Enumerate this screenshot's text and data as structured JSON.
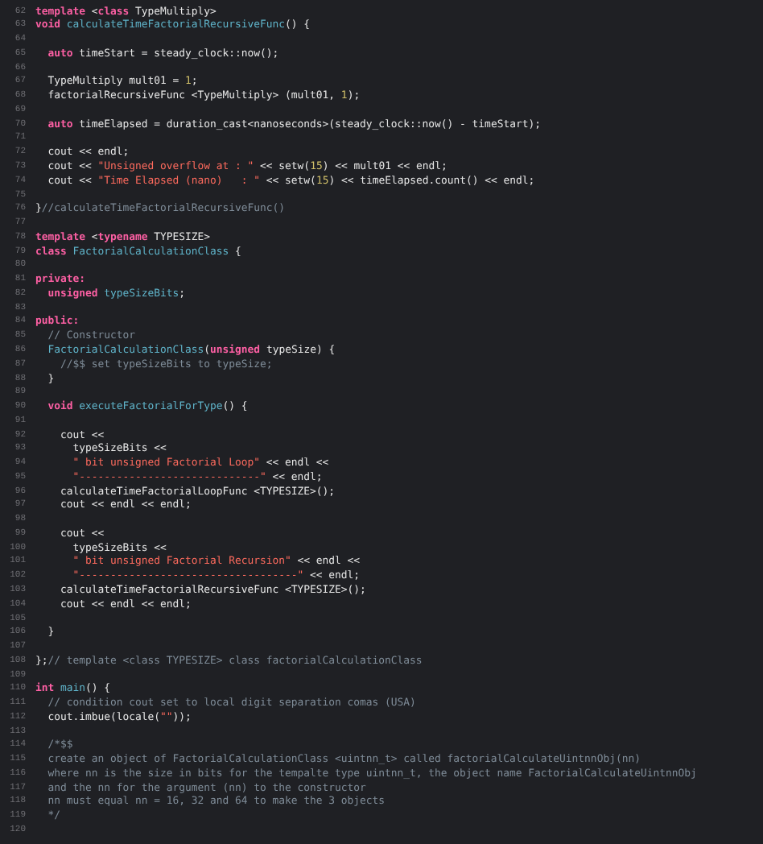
{
  "editor": {
    "lines": [
      {
        "number": "62",
        "tokens": [
          {
            "kind": "keyword",
            "text": "template"
          },
          {
            "kind": "plain",
            "text": " <"
          },
          {
            "kind": "keyword",
            "text": "class"
          },
          {
            "kind": "plain",
            "text": " TypeMultiply>"
          }
        ]
      },
      {
        "number": "63",
        "tokens": [
          {
            "kind": "keyword",
            "text": "void "
          },
          {
            "kind": "function",
            "text": "calculateTimeFactorialRecursiveFunc"
          },
          {
            "kind": "plain",
            "text": "() {"
          }
        ]
      },
      {
        "number": "64"
      },
      {
        "number": "65",
        "tokens": [
          {
            "kind": "keyword",
            "text": "  auto"
          },
          {
            "kind": "plain",
            "text": " timeStart = steady_clock::now();"
          }
        ]
      },
      {
        "number": "66"
      },
      {
        "number": "67",
        "tokens": [
          {
            "kind": "plain",
            "text": "  TypeMultiply mult01 = "
          },
          {
            "kind": "number",
            "text": "1"
          },
          {
            "kind": "plain",
            "text": ";"
          }
        ]
      },
      {
        "number": "68",
        "tokens": [
          {
            "kind": "plain",
            "text": "  factorialRecursiveFunc <TypeMultiply> (mult01, "
          },
          {
            "kind": "number",
            "text": "1"
          },
          {
            "kind": "plain",
            "text": ");"
          }
        ]
      },
      {
        "number": "69"
      },
      {
        "number": "70",
        "tokens": [
          {
            "kind": "keyword",
            "text": "  auto"
          },
          {
            "kind": "plain",
            "text": " timeElapsed = duration_cast<nanoseconds>(steady_clock::now() - timeStart);"
          }
        ]
      },
      {
        "number": "71"
      },
      {
        "number": "72",
        "tokens": [
          {
            "kind": "plain",
            "text": "  cout << endl;"
          }
        ]
      },
      {
        "number": "73",
        "tokens": [
          {
            "kind": "plain",
            "text": "  cout << "
          },
          {
            "kind": "string",
            "text": "\"Unsigned overflow at : \""
          },
          {
            "kind": "plain",
            "text": " << setw("
          },
          {
            "kind": "number",
            "text": "15"
          },
          {
            "kind": "plain",
            "text": ") << mult01 << endl;"
          }
        ]
      },
      {
        "number": "74",
        "tokens": [
          {
            "kind": "plain",
            "text": "  cout << "
          },
          {
            "kind": "string",
            "text": "\"Time Elapsed (nano)   : \""
          },
          {
            "kind": "plain",
            "text": " << setw("
          },
          {
            "kind": "number",
            "text": "15"
          },
          {
            "kind": "plain",
            "text": ") << timeElapsed.count() << endl;"
          }
        ]
      },
      {
        "number": "75"
      },
      {
        "number": "76",
        "tokens": [
          {
            "kind": "plain",
            "text": "}"
          },
          {
            "kind": "comment",
            "text": "//calculateTimeFactorialRecursiveFunc()"
          }
        ]
      },
      {
        "number": "77"
      },
      {
        "number": "78",
        "tokens": [
          {
            "kind": "keyword",
            "text": "template"
          },
          {
            "kind": "plain",
            "text": " <"
          },
          {
            "kind": "keyword",
            "text": "typename"
          },
          {
            "kind": "plain",
            "text": " TYPESIZE>"
          }
        ]
      },
      {
        "number": "79",
        "tokens": [
          {
            "kind": "keyword",
            "text": "class "
          },
          {
            "kind": "function",
            "text": "FactorialCalculationClass"
          },
          {
            "kind": "plain",
            "text": " {"
          }
        ]
      },
      {
        "number": "80"
      },
      {
        "number": "81",
        "tokens": [
          {
            "kind": "keyword",
            "text": "private:"
          }
        ]
      },
      {
        "number": "82",
        "tokens": [
          {
            "kind": "keyword",
            "text": "  unsigned "
          },
          {
            "kind": "function",
            "text": "typeSizeBits"
          },
          {
            "kind": "plain",
            "text": ";"
          }
        ]
      },
      {
        "number": "83"
      },
      {
        "number": "84",
        "tokens": [
          {
            "kind": "keyword",
            "text": "public:"
          }
        ]
      },
      {
        "number": "85",
        "tokens": [
          {
            "kind": "comment",
            "text": "  // Constructor"
          }
        ]
      },
      {
        "number": "86",
        "tokens": [
          {
            "kind": "function",
            "text": "  FactorialCalculationClass"
          },
          {
            "kind": "plain",
            "text": "("
          },
          {
            "kind": "keyword",
            "text": "unsigned"
          },
          {
            "kind": "plain",
            "text": " typeSize) {"
          }
        ]
      },
      {
        "number": "87",
        "tokens": [
          {
            "kind": "comment",
            "text": "    //$$ set typeSizeBits to typeSize;"
          }
        ]
      },
      {
        "number": "88",
        "tokens": [
          {
            "kind": "plain",
            "text": "  }"
          }
        ]
      },
      {
        "number": "89"
      },
      {
        "number": "90",
        "tokens": [
          {
            "kind": "keyword",
            "text": "  void "
          },
          {
            "kind": "function",
            "text": "executeFactorialForType"
          },
          {
            "kind": "plain",
            "text": "() {"
          }
        ]
      },
      {
        "number": "91"
      },
      {
        "number": "92",
        "tokens": [
          {
            "kind": "plain",
            "text": "    cout <<"
          }
        ]
      },
      {
        "number": "93",
        "tokens": [
          {
            "kind": "plain",
            "text": "      typeSizeBits <<"
          }
        ]
      },
      {
        "number": "94",
        "tokens": [
          {
            "kind": "string",
            "text": "      \" bit unsigned Factorial Loop\""
          },
          {
            "kind": "plain",
            "text": " << endl <<"
          }
        ]
      },
      {
        "number": "95",
        "tokens": [
          {
            "kind": "string",
            "text": "      \"-----------------------------\""
          },
          {
            "kind": "plain",
            "text": " << endl;"
          }
        ]
      },
      {
        "number": "96",
        "tokens": [
          {
            "kind": "plain",
            "text": "    calculateTimeFactorialLoopFunc <TYPESIZE>();"
          }
        ]
      },
      {
        "number": "97",
        "tokens": [
          {
            "kind": "plain",
            "text": "    cout << endl << endl;"
          }
        ]
      },
      {
        "number": "98"
      },
      {
        "number": "99",
        "tokens": [
          {
            "kind": "plain",
            "text": "    cout <<"
          }
        ]
      },
      {
        "number": "100",
        "tokens": [
          {
            "kind": "plain",
            "text": "      typeSizeBits <<"
          }
        ]
      },
      {
        "number": "101",
        "tokens": [
          {
            "kind": "string",
            "text": "      \" bit unsigned Factorial Recursion\""
          },
          {
            "kind": "plain",
            "text": " << endl <<"
          }
        ]
      },
      {
        "number": "102",
        "tokens": [
          {
            "kind": "string",
            "text": "      \"-----------------------------------\""
          },
          {
            "kind": "plain",
            "text": " << endl;"
          }
        ]
      },
      {
        "number": "103",
        "tokens": [
          {
            "kind": "plain",
            "text": "    calculateTimeFactorialRecursiveFunc <TYPESIZE>();"
          }
        ]
      },
      {
        "number": "104",
        "tokens": [
          {
            "kind": "plain",
            "text": "    cout << endl << endl;"
          }
        ]
      },
      {
        "number": "105"
      },
      {
        "number": "106",
        "tokens": [
          {
            "kind": "plain",
            "text": "  }"
          }
        ]
      },
      {
        "number": "107"
      },
      {
        "number": "108",
        "tokens": [
          {
            "kind": "plain",
            "text": "};"
          },
          {
            "kind": "comment",
            "text": "// template <class TYPESIZE> class factorialCalculationClass"
          }
        ]
      },
      {
        "number": "109"
      },
      {
        "number": "110",
        "tokens": [
          {
            "kind": "keyword",
            "text": "int "
          },
          {
            "kind": "function",
            "text": "main"
          },
          {
            "kind": "plain",
            "text": "() {"
          }
        ]
      },
      {
        "number": "111",
        "tokens": [
          {
            "kind": "comment",
            "text": "  // condition cout set to local digit separation comas (USA)"
          }
        ]
      },
      {
        "number": "112",
        "tokens": [
          {
            "kind": "plain",
            "text": "  cout.imbue(locale("
          },
          {
            "kind": "string",
            "text": "\"\""
          },
          {
            "kind": "plain",
            "text": "));"
          }
        ]
      },
      {
        "number": "113"
      },
      {
        "number": "114",
        "tokens": [
          {
            "kind": "comment",
            "text": "  /*$$"
          }
        ]
      },
      {
        "number": "115",
        "tokens": [
          {
            "kind": "comment",
            "text": "  create an object of FactorialCalculationClass <uintnn_t> called factorialCalculateUintnnObj(nn)"
          }
        ]
      },
      {
        "number": "116",
        "tokens": [
          {
            "kind": "comment",
            "text": "  where nn is the size in bits for the tempalte type uintnn_t, the object name FactorialCalculateUintnnObj"
          }
        ]
      },
      {
        "number": "117",
        "tokens": [
          {
            "kind": "comment",
            "text": "  and the nn for the argument (nn) to the constructor"
          }
        ]
      },
      {
        "number": "118",
        "tokens": [
          {
            "kind": "comment",
            "text": "  nn must equal nn = 16, 32 and 64 to make the 3 objects"
          }
        ]
      },
      {
        "number": "119",
        "tokens": [
          {
            "kind": "comment",
            "text": "  */"
          }
        ]
      },
      {
        "number": "120"
      }
    ]
  }
}
